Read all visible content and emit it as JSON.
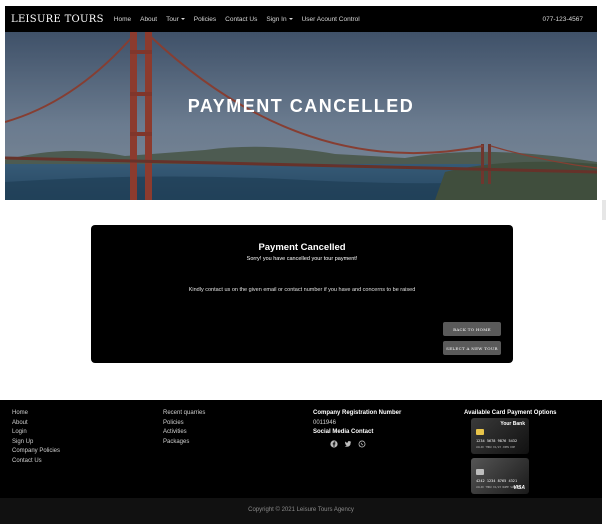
{
  "navbar": {
    "brand": "LEISURE TOURS",
    "items": [
      {
        "label": "Home",
        "dropdown": false
      },
      {
        "label": "About",
        "dropdown": false
      },
      {
        "label": "Tour",
        "dropdown": true
      },
      {
        "label": "Policies",
        "dropdown": false
      },
      {
        "label": "Contact Us",
        "dropdown": false
      },
      {
        "label": "Sign In",
        "dropdown": true
      },
      {
        "label": "User Acount Control",
        "dropdown": false
      }
    ],
    "phone": "077-123-4567"
  },
  "hero": {
    "title": "PAYMENT CANCELLED"
  },
  "card": {
    "title": "Payment Cancelled",
    "subtitle": "Sorry! you have cancelled your tour payment!",
    "message": "Kindly contact us on the given email or contact number if you have and concerns to be raised",
    "back_button": "BACK TO HOME",
    "tour_button": "SELECT A NEW TOUR"
  },
  "footer": {
    "col1": [
      "Home",
      "About",
      "Login",
      "Sign Up",
      "Company Policies",
      "Contact Us"
    ],
    "col2": [
      "Recent quarries",
      "Policies",
      "Activities",
      "Packages"
    ],
    "registration_heading": "Company Registration Number",
    "registration_number": "0011946",
    "social_heading": "Social Media Contact",
    "social_icons": [
      "facebook-icon",
      "twitter-icon",
      "whatsapp-icon"
    ],
    "payment_heading": "Available Card Payment Options",
    "cards": [
      {
        "bank": "Your Bank",
        "number": "1234 5678 9876 5432",
        "small": "VALID THRU 01/23   JOHN DOE"
      },
      {
        "bank": "",
        "number": "4242 1234 8765 4321",
        "small": "VALID THRU 01/23   NAME SURNAME",
        "network": "VISA"
      }
    ],
    "copyright": "Copyright © 2021 Leisure Tours Agency"
  },
  "colors": {
    "navbar_bg": "#000000",
    "card_bg": "#000000",
    "button_bg": "#5a5a5a",
    "footer_bg": "#000000",
    "copyright_bg": "#111111"
  }
}
